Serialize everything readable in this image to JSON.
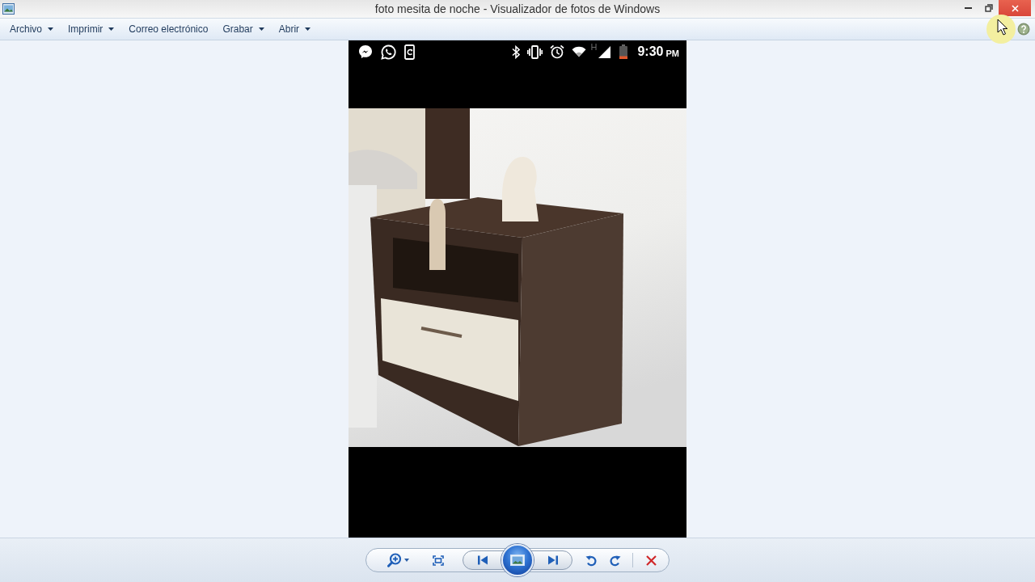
{
  "window": {
    "title": "foto mesita de noche - Visualizador de fotos de Windows"
  },
  "menu": [
    {
      "label": "Archivo",
      "has_menu": true
    },
    {
      "label": "Imprimir",
      "has_menu": true
    },
    {
      "label": "Correo electrónico",
      "has_menu": false
    },
    {
      "label": "Grabar",
      "has_menu": true
    },
    {
      "label": "Abrir",
      "has_menu": true
    }
  ],
  "phone_status_bar": {
    "network_type": "H",
    "time": "9:30",
    "period": "PM"
  }
}
